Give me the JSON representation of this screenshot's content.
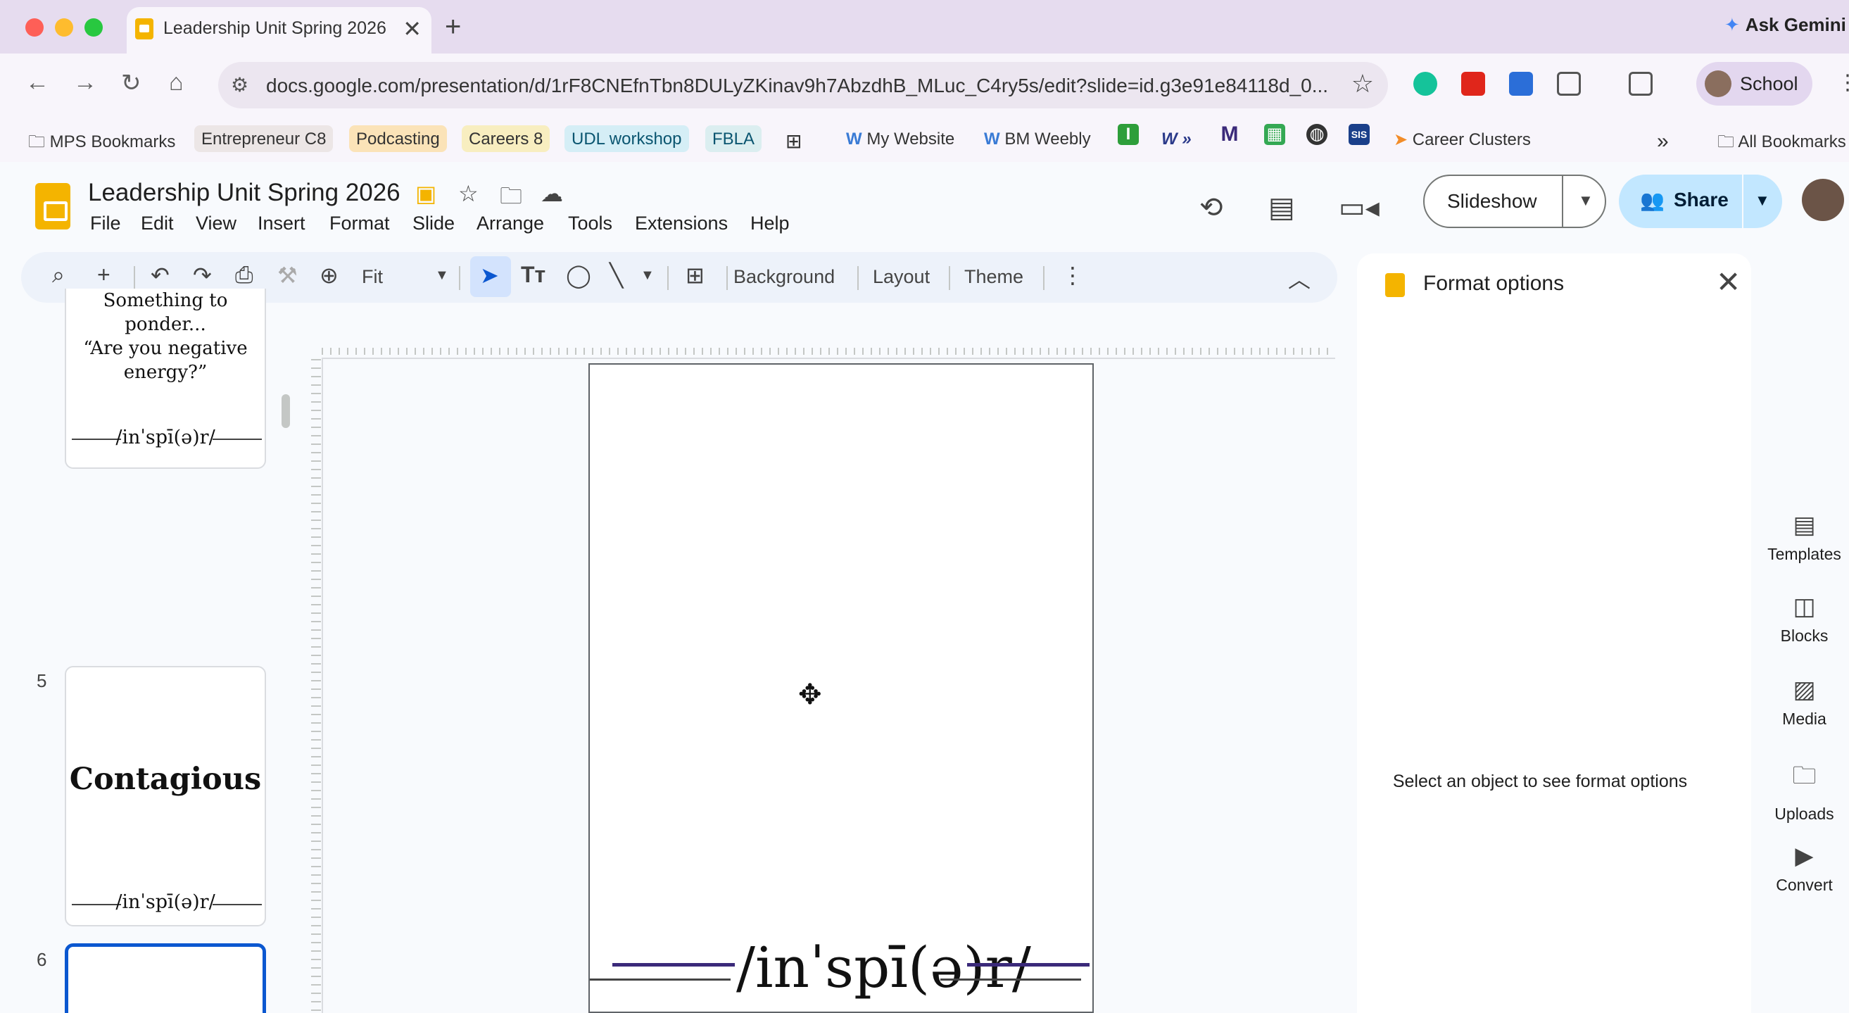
{
  "browser": {
    "tab_title": "Leadership Unit Spring 2026",
    "tab_close": "✕",
    "new_tab": "+",
    "ask_gemini": "Ask Gemini",
    "url": "docs.google.com/presentation/d/1rF8CNEfnTbn8DULyZKinav9h7AbzdhB_MLuc_C4ry5s/edit?slide=id.g3e91e84118d_0...",
    "profile_label": "School",
    "bookmarks": [
      "MPS Bookmarks",
      "Entrepreneur C8",
      "Podcasting",
      "Careers 8",
      "UDL workshop",
      "FBLA",
      "My Website",
      "BM Weebly",
      "Career Clusters"
    ],
    "bookmarks_overflow": "»",
    "all_bookmarks": "All Bookmarks"
  },
  "app": {
    "doc_title": "Leadership Unit Spring 2026",
    "menu": [
      "File",
      "Edit",
      "View",
      "Insert",
      "Format",
      "Slide",
      "Arrange",
      "Tools",
      "Extensions",
      "Help"
    ],
    "slideshow_label": "Slideshow",
    "share_label": "Share",
    "toolbar": {
      "zoom": "Fit",
      "background": "Background",
      "layout": "Layout",
      "theme": "Theme"
    }
  },
  "filmstrip": {
    "slide4": {
      "line1": "Something to",
      "line2": "ponder...",
      "line3": "“Are you negative",
      "line4": "energy?”",
      "footer": "/inˈspī(ə)r/"
    },
    "slide5": {
      "number": "5",
      "title": "Contagious",
      "footer": "/inˈspī(ə)r/"
    },
    "slide6": {
      "number": "6"
    }
  },
  "slide": {
    "footer": "/inˈspī(ə)r/"
  },
  "format_panel": {
    "title": "Format options",
    "message": "Select an object to see format options"
  },
  "side_panel": [
    "Templates",
    "Blocks",
    "Media",
    "Uploads",
    "Convert"
  ],
  "colors": {
    "accent": "#0b57d0",
    "share_bg": "#c2e7ff",
    "slides_yellow": "#f4b400",
    "footer_line": "#3b2a7a"
  }
}
